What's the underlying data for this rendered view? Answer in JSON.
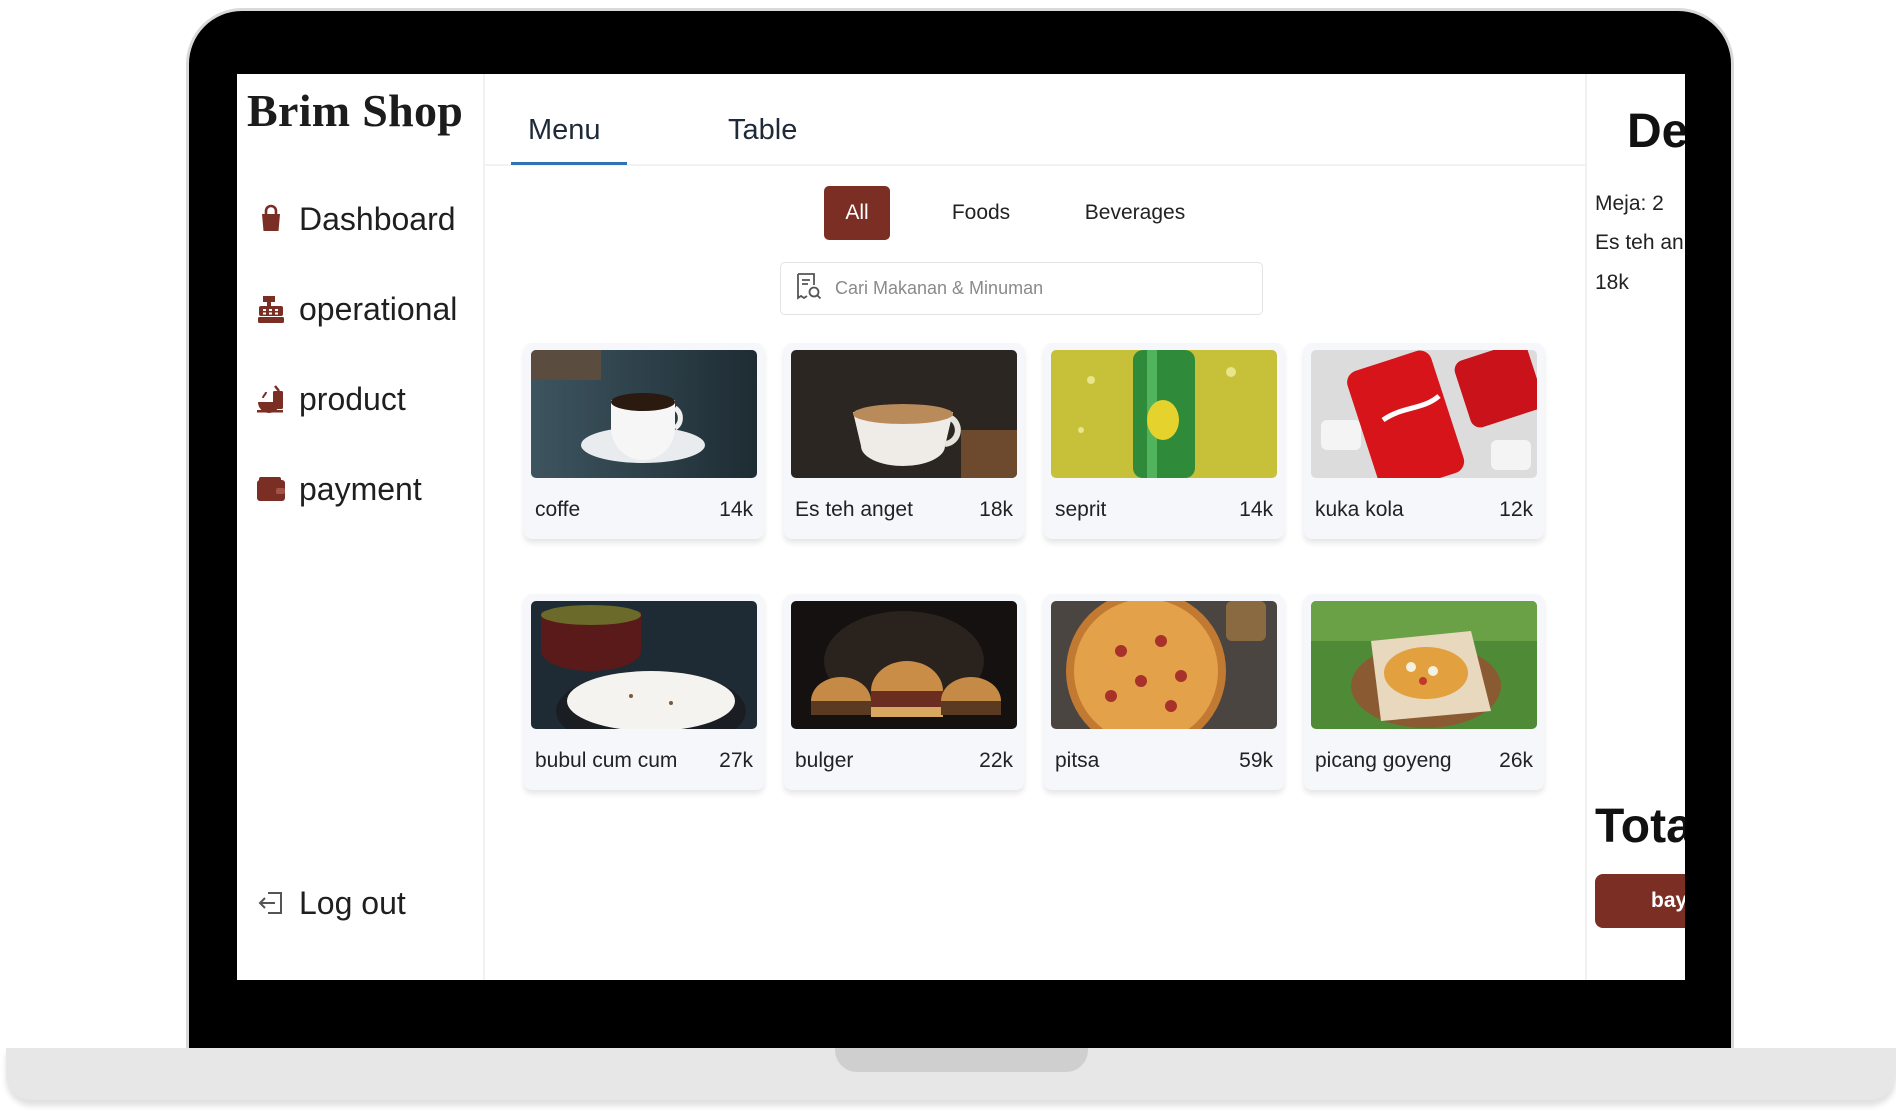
{
  "app": {
    "brand": "Brim Shop",
    "accent_color": "#7a2e24",
    "tab_accent": "#2e74b5"
  },
  "sidebar": {
    "items": [
      {
        "label": "Dashboard",
        "icon": "shopping-bag-icon"
      },
      {
        "label": "operational",
        "icon": "cash-register-icon"
      },
      {
        "label": "product",
        "icon": "food-icon"
      },
      {
        "label": "payment",
        "icon": "wallet-icon"
      }
    ],
    "logout": {
      "label": "Log out",
      "icon": "logout-icon"
    }
  },
  "tabs": [
    {
      "label": "Menu",
      "active": true
    },
    {
      "label": "Table",
      "active": false
    }
  ],
  "filters": [
    {
      "label": "All",
      "active": true
    },
    {
      "label": "Foods",
      "active": false
    },
    {
      "label": "Beverages",
      "active": false
    }
  ],
  "search": {
    "placeholder": "Cari Makanan & Minuman",
    "icon": "receipt-search-icon"
  },
  "products": [
    {
      "name": "coffe",
      "price": "14k"
    },
    {
      "name": "Es teh anget",
      "price": "18k"
    },
    {
      "name": "seprit",
      "price": "14k"
    },
    {
      "name": "kuka kola",
      "price": "12k"
    },
    {
      "name": "bubul cum cum",
      "price": "27k"
    },
    {
      "name": "bulger",
      "price": "22k"
    },
    {
      "name": "pitsa",
      "price": "59k"
    },
    {
      "name": "picang goyeng",
      "price": "26k"
    }
  ],
  "detail": {
    "title": "De",
    "table": "Meja: 2",
    "item": "Es teh an",
    "item_price": "18k",
    "total_label": "Tota",
    "pay_label": "bay"
  }
}
